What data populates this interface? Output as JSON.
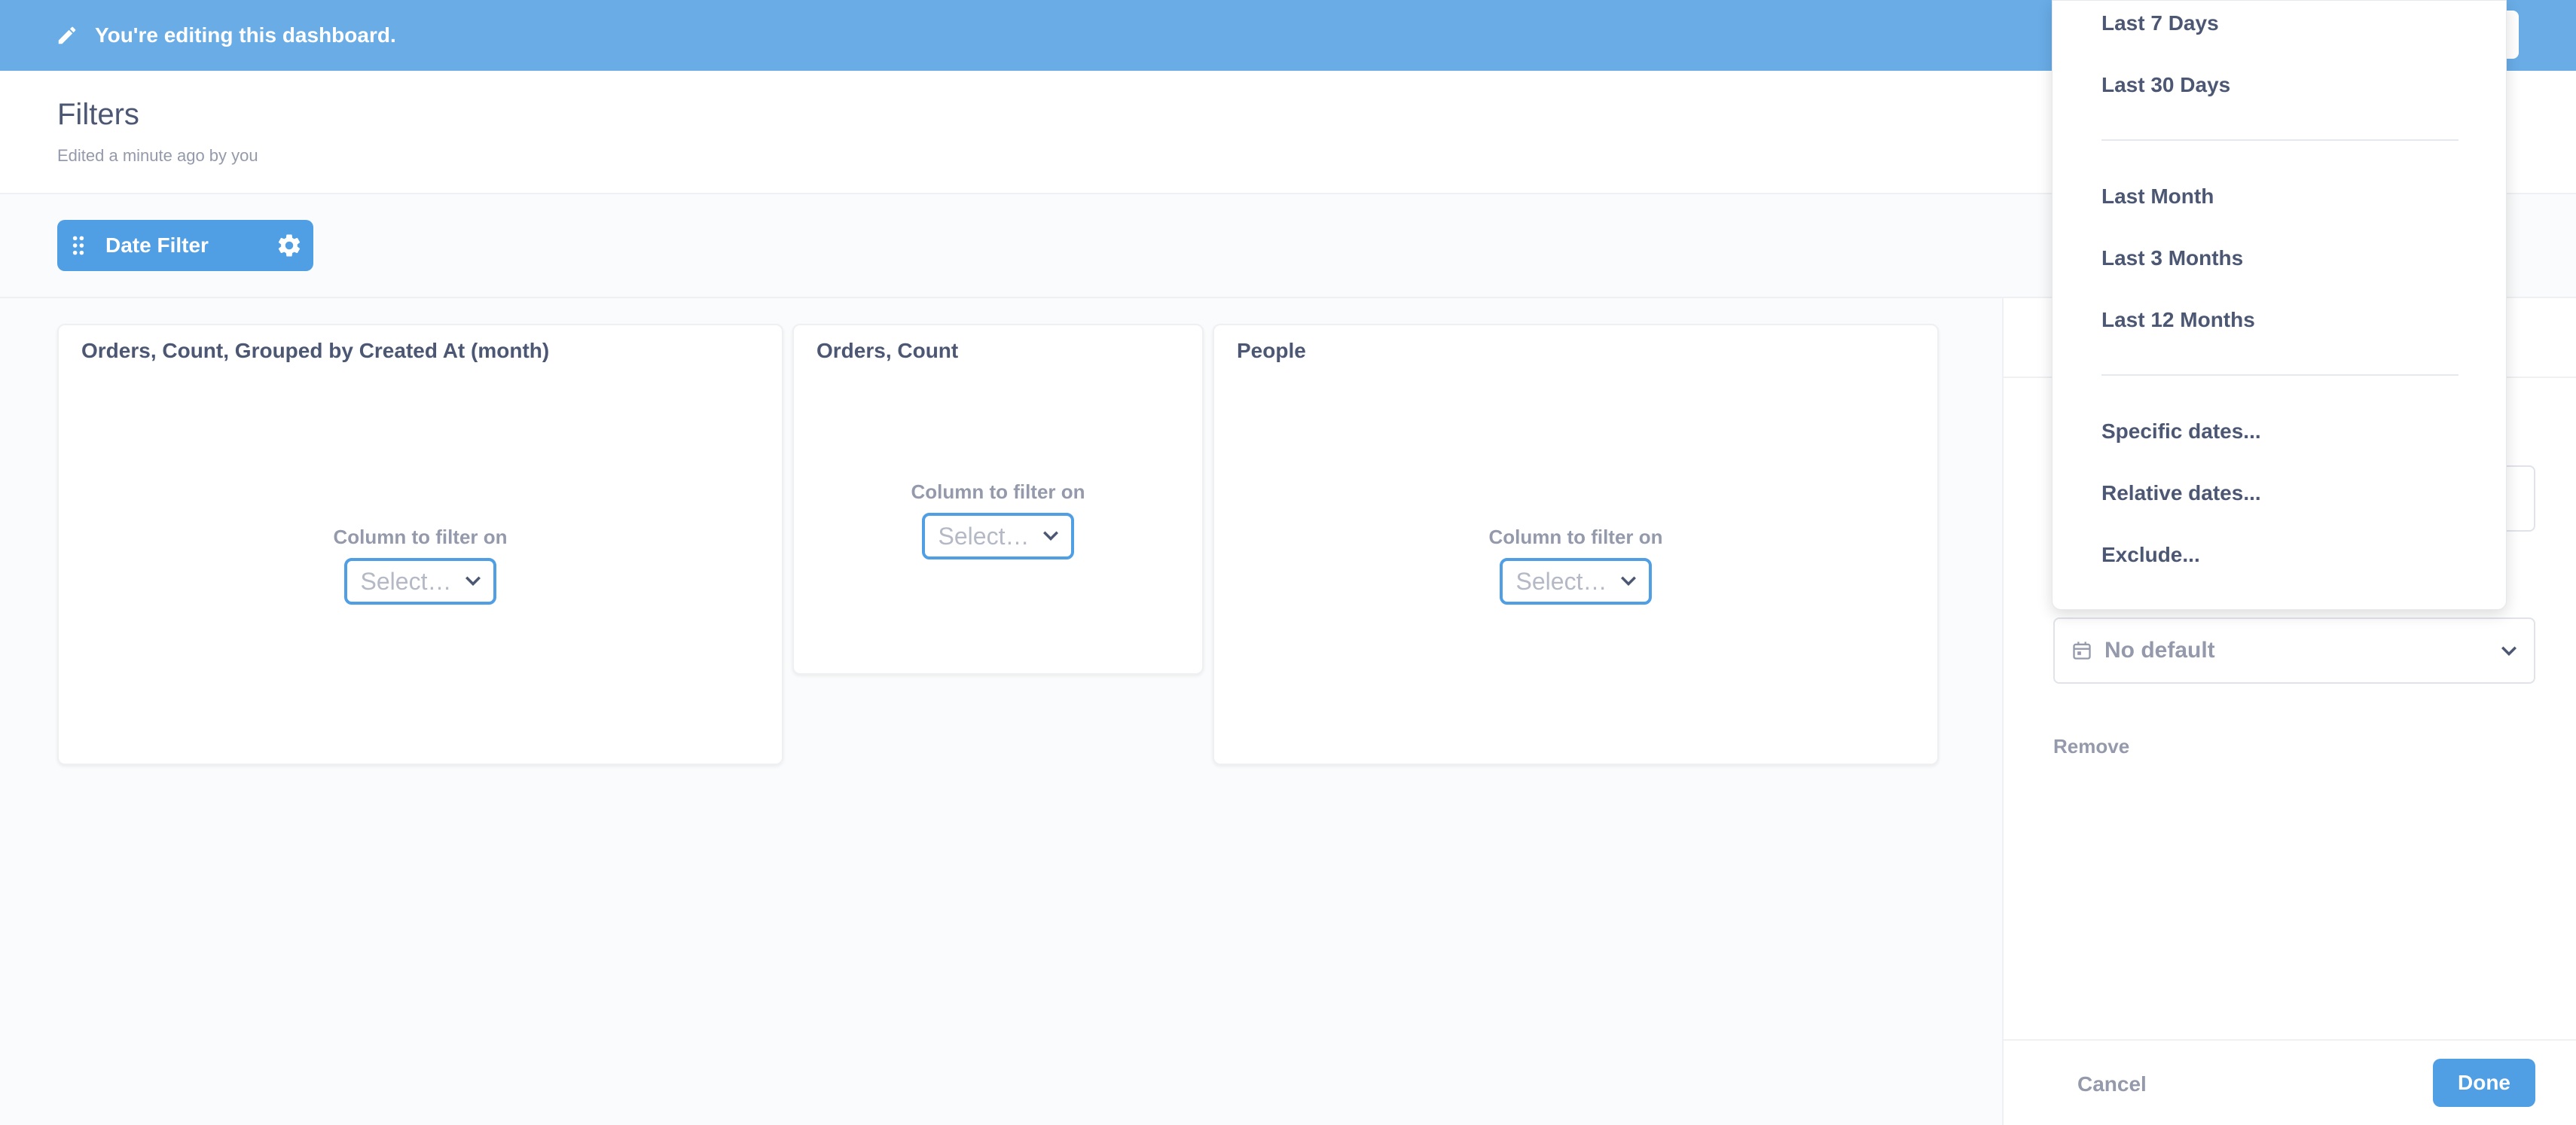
{
  "banner": {
    "text": "You're editing this dashboard.",
    "icon": "pencil-icon"
  },
  "header": {
    "title": "Filters",
    "subtitle": "Edited a minute ago by you"
  },
  "filter_bar": {
    "widget_label": "Date Filter",
    "handle_icon": "grab-handle-icon",
    "settings_icon": "gear-icon"
  },
  "cards": [
    {
      "title": "Orders, Count, Grouped by Created At (month)",
      "mapping_label": "Column to filter on",
      "select_text": "Select…"
    },
    {
      "title": "Orders, Count",
      "mapping_label": "Column to filter on",
      "select_text": "Select…"
    },
    {
      "title": "People",
      "mapping_label": "Column to filter on",
      "select_text": "Select…"
    }
  ],
  "sidebar": {
    "default_value": "No default",
    "remove_label": "Remove",
    "cancel_label": "Cancel",
    "done_label": "Done"
  },
  "dropdown": {
    "groups": [
      [
        "Last 7 Days",
        "Last 30 Days"
      ],
      [
        "Last Month",
        "Last 3 Months",
        "Last 12 Months"
      ],
      [
        "Specific dates...",
        "Relative dates...",
        "Exclude..."
      ]
    ]
  },
  "colors": {
    "brand": "#509ee3",
    "banner": "#69ace6",
    "text_dark": "#4c5773",
    "text_muted": "#949aab"
  }
}
